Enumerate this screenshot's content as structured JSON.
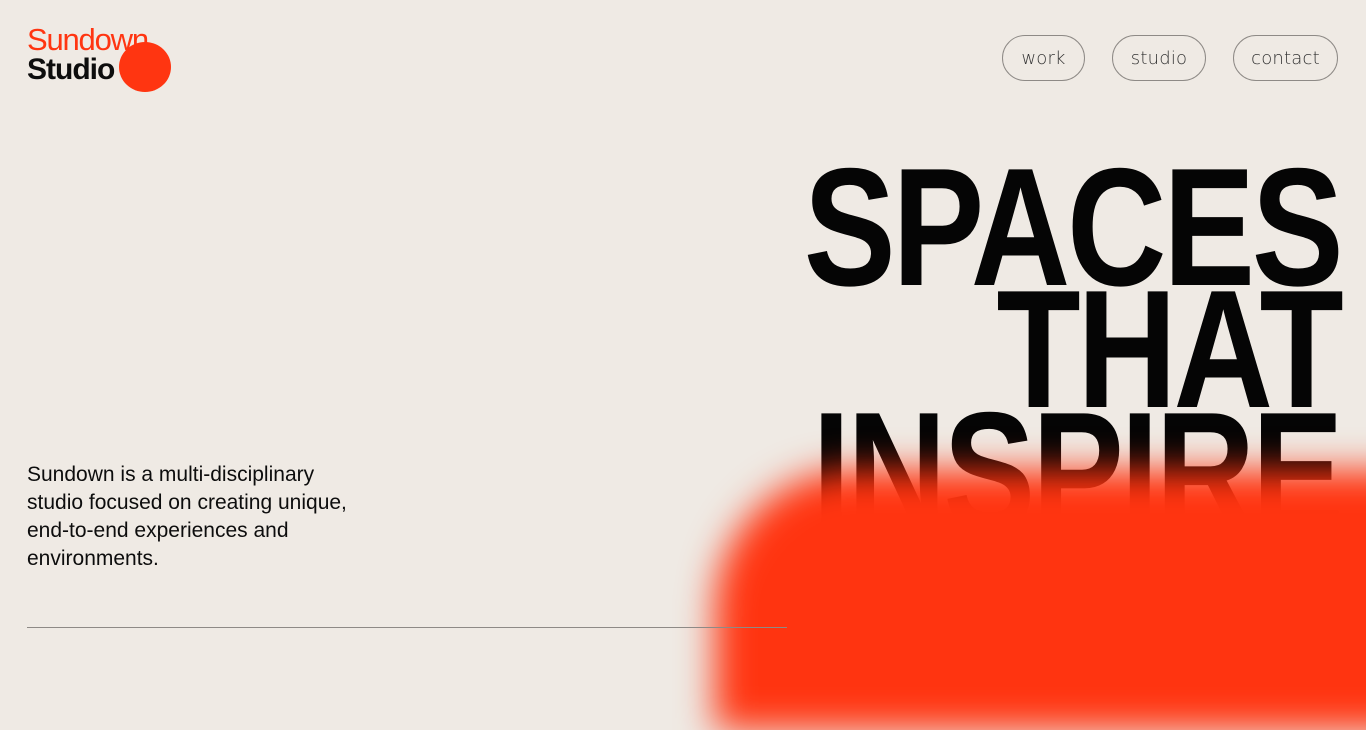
{
  "logo": {
    "line1": "Sundown",
    "line2": "Studio"
  },
  "nav": {
    "items": [
      {
        "label": "work"
      },
      {
        "label": "studio"
      },
      {
        "label": "contact"
      }
    ]
  },
  "hero": {
    "lines": [
      "SPACES",
      "THAT",
      "INSPIRE"
    ]
  },
  "intro": {
    "text": "Sundown is a multi-disciplinary studio focused on creating unique, end-to-end experiences and environments."
  },
  "colors": {
    "background": "#efeae4",
    "accent": "#ff3511",
    "text": "#0d0d0d"
  }
}
